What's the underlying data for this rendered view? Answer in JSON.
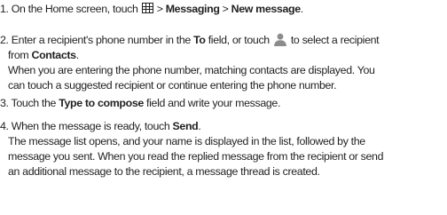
{
  "steps": [
    {
      "number": "1.",
      "text_a": "On the Home screen, touch",
      "icon": "apps-grid-icon",
      "text_b": " > ",
      "bold_a": "Messaging",
      "text_c": " > ",
      "bold_b": "New message",
      "text_d": "."
    },
    {
      "number": "2.",
      "text_a": "Enter a recipient's phone number in the ",
      "bold_a": "To",
      "text_b": " field, or touch",
      "icon": "contact-person-icon",
      "text_c": "to select a recipient",
      "line2_text": "from ",
      "line2_bold": "Contacts",
      "line2_end": ".",
      "note_line1": "When you are entering the phone number, matching contacts are displayed. You",
      "note_line2": "can touch a suggested recipient or continue entering the phone number."
    },
    {
      "number": "3.",
      "text_a": "Touch the ",
      "bold_a": "Type to compose",
      "text_b": " field and write your message."
    },
    {
      "number": "4.",
      "text_a": "When the message is ready, touch ",
      "bold_a": "Send",
      "text_b": ".",
      "note_line1": "The message list opens, and your name is displayed in the list, followed by the",
      "note_line2": "message you sent. When you read the replied message from the recipient or send",
      "note_line3": "an additional message to the recipient, a message thread is created."
    }
  ],
  "colors": {
    "text": "#231f20",
    "contact_icon": "#8c8c8c"
  }
}
